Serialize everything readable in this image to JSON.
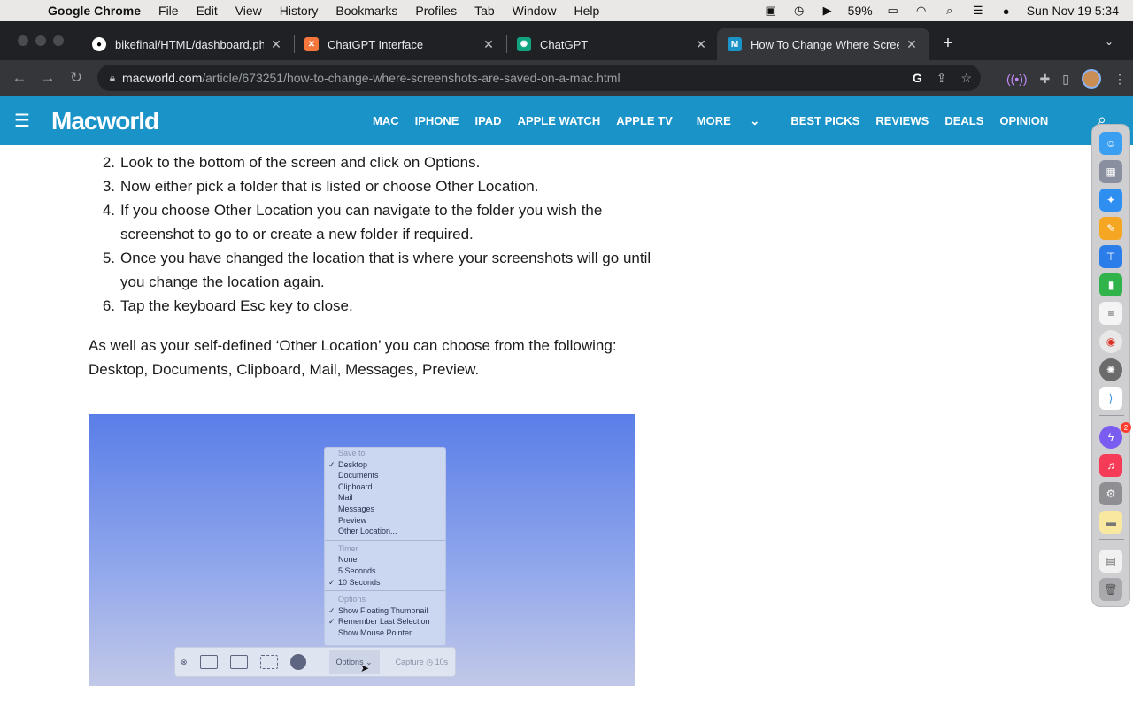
{
  "menubar": {
    "app": "Google Chrome",
    "items": [
      "File",
      "Edit",
      "View",
      "History",
      "Bookmarks",
      "Profiles",
      "Tab",
      "Window",
      "Help"
    ],
    "battery": "59%",
    "clock": "Sun Nov 19  5:34"
  },
  "tabs": [
    {
      "title": "bikefinal/HTML/dashboard.php",
      "icon": "github-icon"
    },
    {
      "title": "ChatGPT Interface",
      "icon": "xampp-icon"
    },
    {
      "title": "ChatGPT",
      "icon": "chatgpt-icon"
    },
    {
      "title": "How To Change Where Screen",
      "icon": "macworld-icon"
    }
  ],
  "omnibox": {
    "host": "macworld.com",
    "path": "/article/673251/how-to-change-where-screenshots-are-saved-on-a-mac.html"
  },
  "site": {
    "logo": "Macworld",
    "nav": [
      "MAC",
      "IPHONE",
      "IPAD",
      "APPLE WATCH",
      "APPLE TV",
      "MORE",
      "BEST PICKS",
      "REVIEWS",
      "DEALS",
      "OPINION"
    ]
  },
  "article": {
    "steps": [
      {
        "num": "2.",
        "text": "Look to the bottom of the screen and click on Options."
      },
      {
        "num": "3.",
        "text": "Now either pick a folder that is listed or choose Other Location."
      },
      {
        "num": "4.",
        "text": "If you choose Other Location you can navigate to the folder you wish the screenshot to go to or create a new folder if required."
      },
      {
        "num": "5.",
        "text": "Once you have changed the location that is where your screenshots will go until you change the location again."
      },
      {
        "num": "6.",
        "text": "Tap the keyboard Esc key to close."
      }
    ],
    "paragraph": "As well as your self-defined ‘Other Location’ you can choose from the following: Desktop, Documents, Clipboard, Mail, Messages, Preview."
  },
  "figure": {
    "save_header": "Save to",
    "save_items": [
      "Desktop",
      "Documents",
      "Clipboard",
      "Mail",
      "Messages",
      "Preview",
      "Other Location..."
    ],
    "timer_header": "Timer",
    "timer_items": [
      "None",
      "5 Seconds",
      "10 Seconds"
    ],
    "options_header": "Options",
    "options_items": [
      "Show Floating Thumbnail",
      "Remember Last Selection",
      "Show Mouse Pointer"
    ],
    "options_button": "Options",
    "capture_button": "Capture",
    "capture_timer": "10s"
  },
  "dock": {
    "messenger_badge": "2"
  }
}
